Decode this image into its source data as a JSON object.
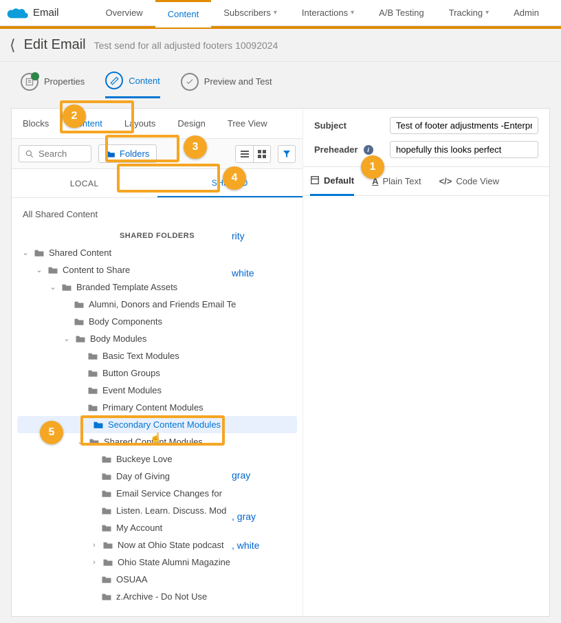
{
  "appName": "Email",
  "topNav": [
    "Overview",
    "Content",
    "Subscribers",
    "Interactions",
    "A/B Testing",
    "Tracking",
    "Admin"
  ],
  "topNavActive": "Content",
  "topNavDropdown": {
    "Subscribers": true,
    "Interactions": true,
    "Tracking": true
  },
  "pageTitle": "Edit Email",
  "pageSubtitle": "Test send for all adjusted footers 10092024",
  "steps": {
    "properties": "Properties",
    "content": "Content",
    "preview": "Preview and Test"
  },
  "subTabs": [
    "Blocks",
    "Content",
    "Layouts",
    "Design",
    "Tree View"
  ],
  "subTabActive": "Content",
  "searchPlaceholder": "Search",
  "foldersLabel": "Folders",
  "lsTabs": {
    "local": "LOCAL",
    "shared": "SHARED"
  },
  "lsActive": "SHARED",
  "allSharedLabel": "All Shared Content",
  "sharedFoldersHeader": "SHARED FOLDERS",
  "tree": {
    "root": "Shared Content",
    "cts": "Content to Share",
    "bta": "Branded Template Assets",
    "bta_children": [
      "Alumni, Donors and Friends Email Te",
      "Body Components"
    ],
    "bm": "Body Modules",
    "bm_children": [
      "Basic Text Modules",
      "Button Groups",
      "Event Modules",
      "Primary Content Modules"
    ],
    "scm": "Secondary Content Modules",
    "shcm": "Shared Content Modules",
    "shcm_children": [
      "Buckeye Love",
      "Day of Giving",
      "Email Service Changes for",
      "Listen. Learn. Discuss. Mod",
      "My Account",
      "Now at Ohio State podcast",
      "Ohio State Alumni Magazine",
      "OSUAA",
      "z.Archive - Do Not Use"
    ],
    "shcm_expandable": {
      "Now at Ohio State podcast": true,
      "Ohio State Alumni Magazine": true
    }
  },
  "subject": {
    "label": "Subject",
    "value": "Test of footer adjustments -Enterprise UC"
  },
  "preheader": {
    "label": "Preheader",
    "value": "hopefully this looks perfect"
  },
  "viewTabs": {
    "default": "Default",
    "plain": "Plain Text",
    "code": "Code View"
  },
  "peekItems": [
    "rity",
    "white",
    "",
    "",
    "",
    "gray",
    ", gray",
    ", white"
  ],
  "callouts": {
    "c1": "1",
    "c2": "2",
    "c3": "3",
    "c4": "4",
    "c5": "5"
  }
}
